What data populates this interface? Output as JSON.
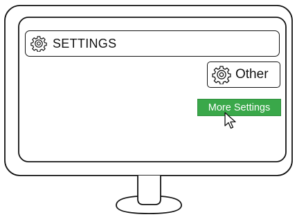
{
  "header": {
    "title": "SETTINGS",
    "icon": "gear-icon"
  },
  "options": {
    "other_label": "Other",
    "other_icon": "gear-icon",
    "more_settings_label": "More Settings",
    "more_settings_color": "#3aa84a"
  },
  "pointer": {
    "icon": "mouse-cursor-icon"
  }
}
